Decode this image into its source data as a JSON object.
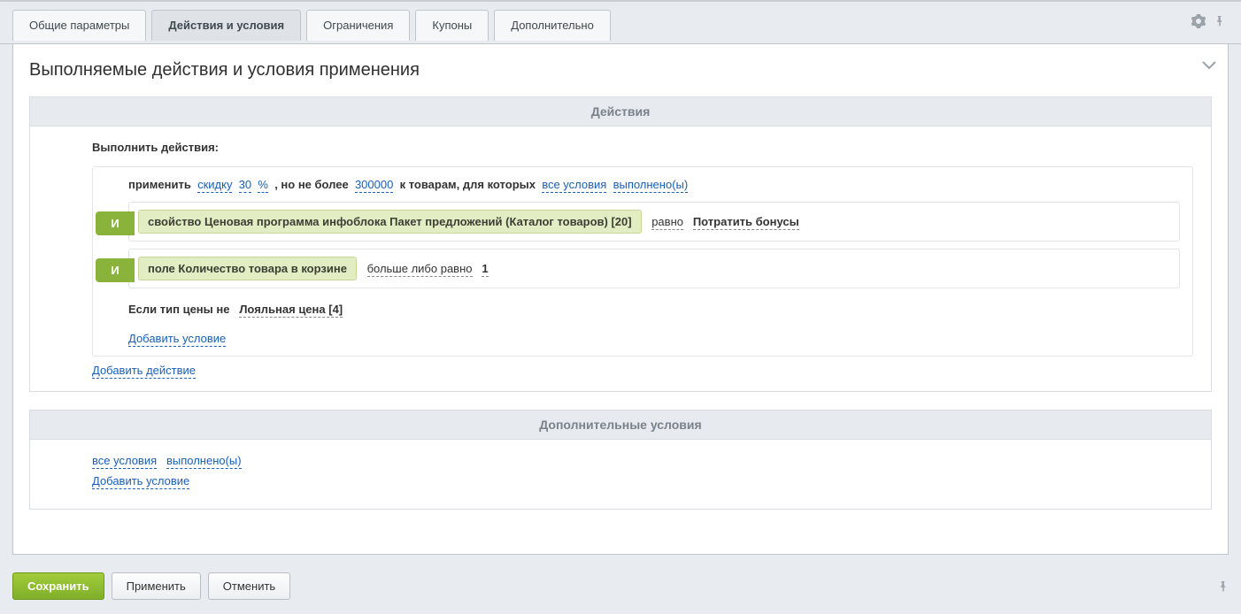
{
  "tabs": {
    "general": "Общие параметры",
    "actions": "Действия и условия",
    "limits": "Ограничения",
    "coupons": "Купоны",
    "extra": "Дополнительно"
  },
  "panel": {
    "title": "Выполняемые действия и условия применения"
  },
  "section_actions": {
    "header": "Действия",
    "run_label": "Выполнить действия:",
    "apply": "применить",
    "discount": "скидку",
    "discount_value": "30",
    "discount_unit": "%",
    "but_not_more": ", но не более",
    "max_value": "300000",
    "to_products": "к товарам, для которых",
    "all_conditions": "все условия",
    "fulfilled": "выполнено(ы)",
    "and_label": "И",
    "cond1_chip": "свойство Ценовая программа инфоблока Пакет предложений (Каталог товаров) [20]",
    "cond1_op": "равно",
    "cond1_val": "Потратить бонусы",
    "cond2_chip": "поле Количество товара в корзине",
    "cond2_op": "больше либо равно",
    "cond2_val": "1",
    "cond3_prefix": "Если тип цены не",
    "cond3_val": "Лояльная цена [4]",
    "add_condition": "Добавить условие",
    "add_action": "Добавить действие"
  },
  "section_extra": {
    "header": "Дополнительные условия",
    "all_conditions": "все условия",
    "fulfilled": "выполнено(ы)",
    "add_condition": "Добавить условие"
  },
  "footer": {
    "save": "Сохранить",
    "apply": "Применить",
    "cancel": "Отменить"
  }
}
